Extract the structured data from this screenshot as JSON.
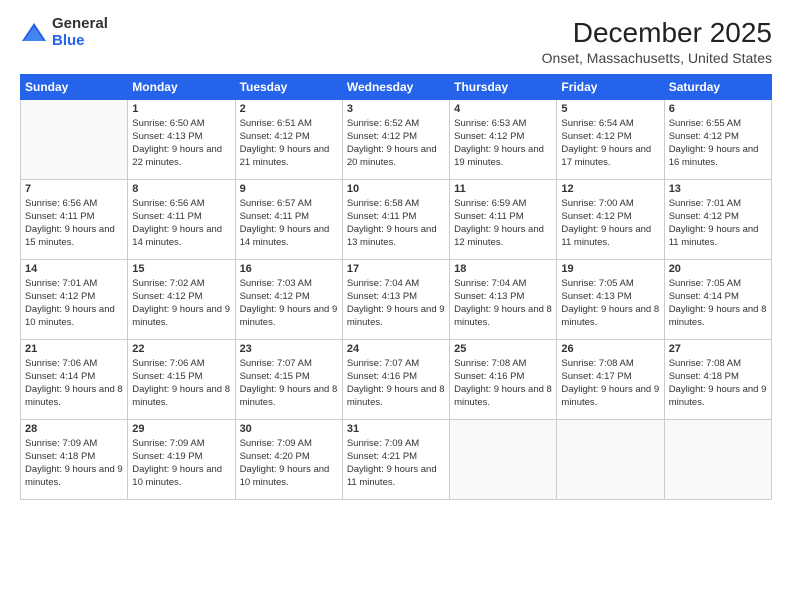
{
  "logo": {
    "general": "General",
    "blue": "Blue"
  },
  "header": {
    "title": "December 2025",
    "subtitle": "Onset, Massachusetts, United States"
  },
  "weekdays": [
    "Sunday",
    "Monday",
    "Tuesday",
    "Wednesday",
    "Thursday",
    "Friday",
    "Saturday"
  ],
  "weeks": [
    [
      {
        "day": "",
        "sunrise": "",
        "sunset": "",
        "daylight": "",
        "empty": true
      },
      {
        "day": "1",
        "sunrise": "Sunrise: 6:50 AM",
        "sunset": "Sunset: 4:13 PM",
        "daylight": "Daylight: 9 hours and 22 minutes.",
        "empty": false
      },
      {
        "day": "2",
        "sunrise": "Sunrise: 6:51 AM",
        "sunset": "Sunset: 4:12 PM",
        "daylight": "Daylight: 9 hours and 21 minutes.",
        "empty": false
      },
      {
        "day": "3",
        "sunrise": "Sunrise: 6:52 AM",
        "sunset": "Sunset: 4:12 PM",
        "daylight": "Daylight: 9 hours and 20 minutes.",
        "empty": false
      },
      {
        "day": "4",
        "sunrise": "Sunrise: 6:53 AM",
        "sunset": "Sunset: 4:12 PM",
        "daylight": "Daylight: 9 hours and 19 minutes.",
        "empty": false
      },
      {
        "day": "5",
        "sunrise": "Sunrise: 6:54 AM",
        "sunset": "Sunset: 4:12 PM",
        "daylight": "Daylight: 9 hours and 17 minutes.",
        "empty": false
      },
      {
        "day": "6",
        "sunrise": "Sunrise: 6:55 AM",
        "sunset": "Sunset: 4:12 PM",
        "daylight": "Daylight: 9 hours and 16 minutes.",
        "empty": false
      }
    ],
    [
      {
        "day": "7",
        "sunrise": "Sunrise: 6:56 AM",
        "sunset": "Sunset: 4:11 PM",
        "daylight": "Daylight: 9 hours and 15 minutes.",
        "empty": false
      },
      {
        "day": "8",
        "sunrise": "Sunrise: 6:56 AM",
        "sunset": "Sunset: 4:11 PM",
        "daylight": "Daylight: 9 hours and 14 minutes.",
        "empty": false
      },
      {
        "day": "9",
        "sunrise": "Sunrise: 6:57 AM",
        "sunset": "Sunset: 4:11 PM",
        "daylight": "Daylight: 9 hours and 14 minutes.",
        "empty": false
      },
      {
        "day": "10",
        "sunrise": "Sunrise: 6:58 AM",
        "sunset": "Sunset: 4:11 PM",
        "daylight": "Daylight: 9 hours and 13 minutes.",
        "empty": false
      },
      {
        "day": "11",
        "sunrise": "Sunrise: 6:59 AM",
        "sunset": "Sunset: 4:11 PM",
        "daylight": "Daylight: 9 hours and 12 minutes.",
        "empty": false
      },
      {
        "day": "12",
        "sunrise": "Sunrise: 7:00 AM",
        "sunset": "Sunset: 4:12 PM",
        "daylight": "Daylight: 9 hours and 11 minutes.",
        "empty": false
      },
      {
        "day": "13",
        "sunrise": "Sunrise: 7:01 AM",
        "sunset": "Sunset: 4:12 PM",
        "daylight": "Daylight: 9 hours and 11 minutes.",
        "empty": false
      }
    ],
    [
      {
        "day": "14",
        "sunrise": "Sunrise: 7:01 AM",
        "sunset": "Sunset: 4:12 PM",
        "daylight": "Daylight: 9 hours and 10 minutes.",
        "empty": false
      },
      {
        "day": "15",
        "sunrise": "Sunrise: 7:02 AM",
        "sunset": "Sunset: 4:12 PM",
        "daylight": "Daylight: 9 hours and 9 minutes.",
        "empty": false
      },
      {
        "day": "16",
        "sunrise": "Sunrise: 7:03 AM",
        "sunset": "Sunset: 4:12 PM",
        "daylight": "Daylight: 9 hours and 9 minutes.",
        "empty": false
      },
      {
        "day": "17",
        "sunrise": "Sunrise: 7:04 AM",
        "sunset": "Sunset: 4:13 PM",
        "daylight": "Daylight: 9 hours and 9 minutes.",
        "empty": false
      },
      {
        "day": "18",
        "sunrise": "Sunrise: 7:04 AM",
        "sunset": "Sunset: 4:13 PM",
        "daylight": "Daylight: 9 hours and 8 minutes.",
        "empty": false
      },
      {
        "day": "19",
        "sunrise": "Sunrise: 7:05 AM",
        "sunset": "Sunset: 4:13 PM",
        "daylight": "Daylight: 9 hours and 8 minutes.",
        "empty": false
      },
      {
        "day": "20",
        "sunrise": "Sunrise: 7:05 AM",
        "sunset": "Sunset: 4:14 PM",
        "daylight": "Daylight: 9 hours and 8 minutes.",
        "empty": false
      }
    ],
    [
      {
        "day": "21",
        "sunrise": "Sunrise: 7:06 AM",
        "sunset": "Sunset: 4:14 PM",
        "daylight": "Daylight: 9 hours and 8 minutes.",
        "empty": false
      },
      {
        "day": "22",
        "sunrise": "Sunrise: 7:06 AM",
        "sunset": "Sunset: 4:15 PM",
        "daylight": "Daylight: 9 hours and 8 minutes.",
        "empty": false
      },
      {
        "day": "23",
        "sunrise": "Sunrise: 7:07 AM",
        "sunset": "Sunset: 4:15 PM",
        "daylight": "Daylight: 9 hours and 8 minutes.",
        "empty": false
      },
      {
        "day": "24",
        "sunrise": "Sunrise: 7:07 AM",
        "sunset": "Sunset: 4:16 PM",
        "daylight": "Daylight: 9 hours and 8 minutes.",
        "empty": false
      },
      {
        "day": "25",
        "sunrise": "Sunrise: 7:08 AM",
        "sunset": "Sunset: 4:16 PM",
        "daylight": "Daylight: 9 hours and 8 minutes.",
        "empty": false
      },
      {
        "day": "26",
        "sunrise": "Sunrise: 7:08 AM",
        "sunset": "Sunset: 4:17 PM",
        "daylight": "Daylight: 9 hours and 9 minutes.",
        "empty": false
      },
      {
        "day": "27",
        "sunrise": "Sunrise: 7:08 AM",
        "sunset": "Sunset: 4:18 PM",
        "daylight": "Daylight: 9 hours and 9 minutes.",
        "empty": false
      }
    ],
    [
      {
        "day": "28",
        "sunrise": "Sunrise: 7:09 AM",
        "sunset": "Sunset: 4:18 PM",
        "daylight": "Daylight: 9 hours and 9 minutes.",
        "empty": false
      },
      {
        "day": "29",
        "sunrise": "Sunrise: 7:09 AM",
        "sunset": "Sunset: 4:19 PM",
        "daylight": "Daylight: 9 hours and 10 minutes.",
        "empty": false
      },
      {
        "day": "30",
        "sunrise": "Sunrise: 7:09 AM",
        "sunset": "Sunset: 4:20 PM",
        "daylight": "Daylight: 9 hours and 10 minutes.",
        "empty": false
      },
      {
        "day": "31",
        "sunrise": "Sunrise: 7:09 AM",
        "sunset": "Sunset: 4:21 PM",
        "daylight": "Daylight: 9 hours and 11 minutes.",
        "empty": false
      },
      {
        "day": "",
        "sunrise": "",
        "sunset": "",
        "daylight": "",
        "empty": true
      },
      {
        "day": "",
        "sunrise": "",
        "sunset": "",
        "daylight": "",
        "empty": true
      },
      {
        "day": "",
        "sunrise": "",
        "sunset": "",
        "daylight": "",
        "empty": true
      }
    ]
  ]
}
